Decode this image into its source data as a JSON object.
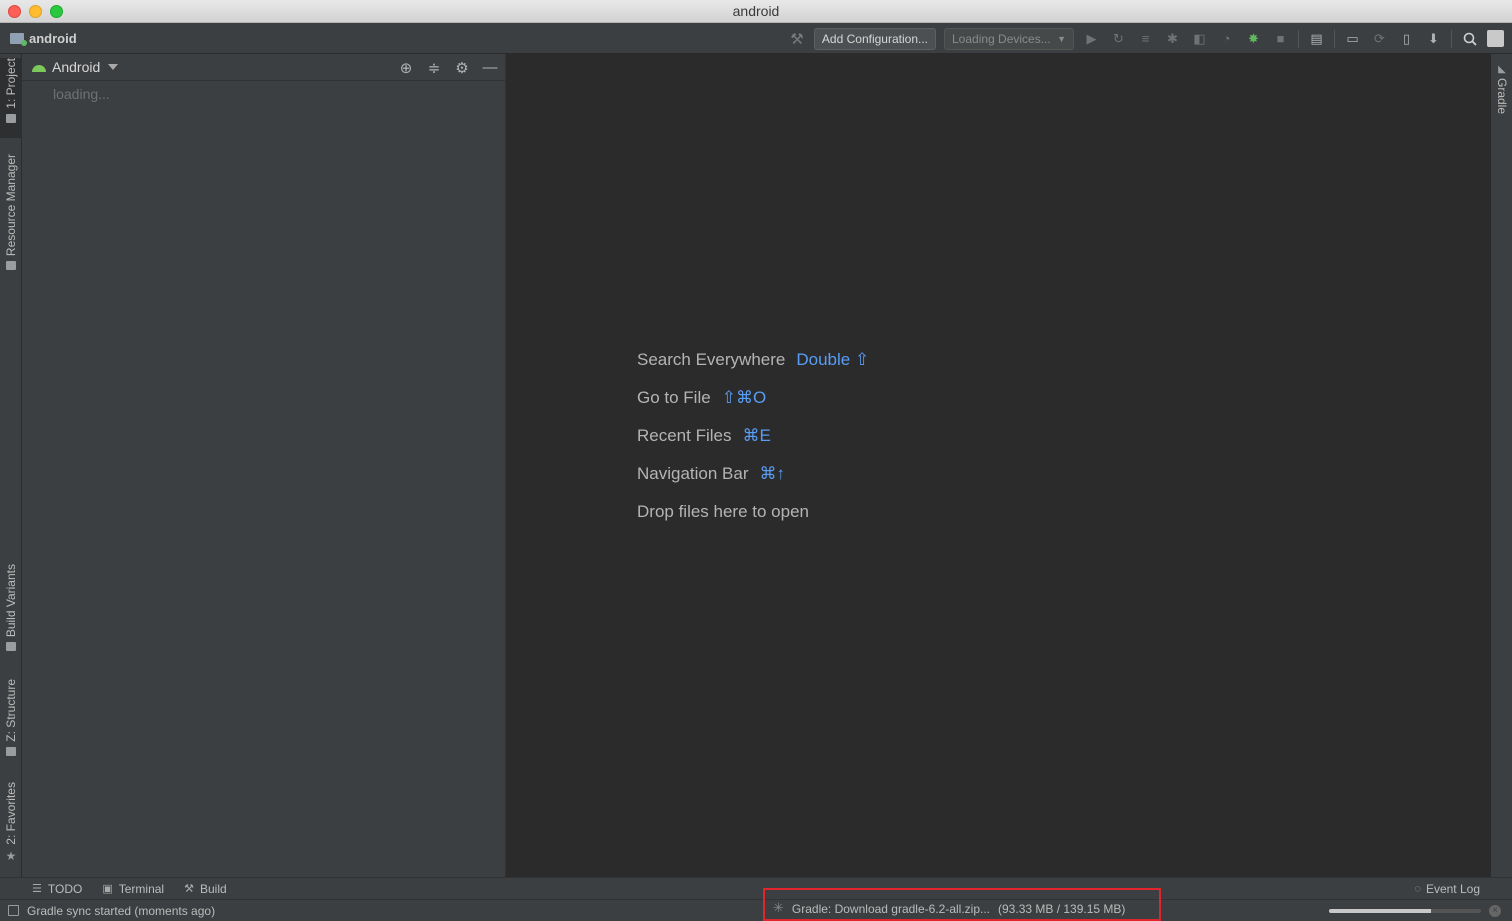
{
  "window": {
    "title": "android"
  },
  "toolbar": {
    "project_name": "android",
    "add_config_label": "Add Configuration...",
    "devices_label": "Loading Devices..."
  },
  "left_stripe": {
    "project": "1: Project",
    "resource_manager": "Resource Manager",
    "build_variants": "Build Variants",
    "structure": "Z: Structure",
    "favorites": "2: Favorites"
  },
  "right_stripe": {
    "gradle": "Gradle"
  },
  "project_panel": {
    "view": "Android",
    "loading": "loading..."
  },
  "editor": {
    "hints": [
      {
        "label": "Search Everywhere",
        "shortcut": "Double ⇧"
      },
      {
        "label": "Go to File",
        "shortcut": "⇧⌘O"
      },
      {
        "label": "Recent Files",
        "shortcut": "⌘E"
      },
      {
        "label": "Navigation Bar",
        "shortcut": "⌘↑"
      },
      {
        "label": "Drop files here to open",
        "shortcut": ""
      }
    ]
  },
  "bottom_tabs": {
    "todo": "TODO",
    "terminal": "Terminal",
    "build": "Build",
    "event_log": "Event Log"
  },
  "status": {
    "message": "Gradle sync started (moments ago)",
    "progress_text": "Gradle: Download gradle-6.2-all.zip...",
    "progress_size": "(93.33 MB / 139.15 MB)",
    "progress_fraction": 0.67
  },
  "colors": {
    "accent_shortcut": "#589df6",
    "android_green": "#7cc85a",
    "highlight_box": "#e0262c"
  }
}
